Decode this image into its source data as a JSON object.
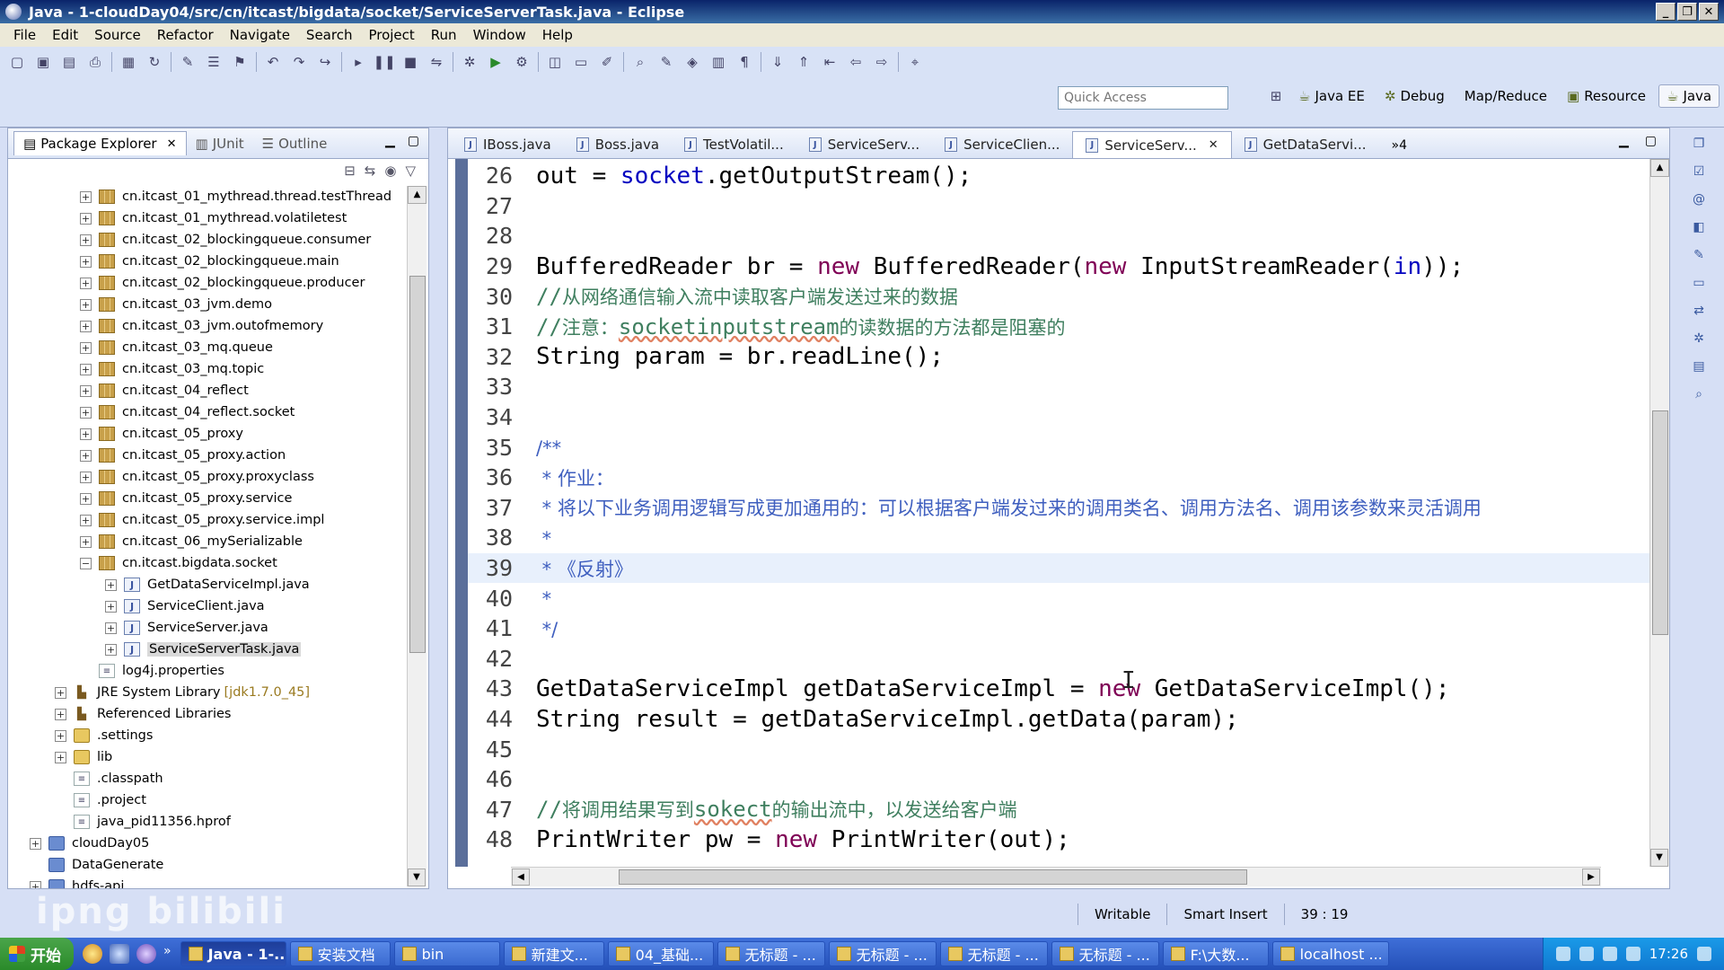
{
  "window": {
    "title": "Java - 1-cloudDay04/src/cn/itcast/bigdata/socket/ServiceServerTask.java - Eclipse",
    "controls": [
      "_",
      "❐",
      "✕"
    ]
  },
  "menu": [
    "File",
    "Edit",
    "Source",
    "Refactor",
    "Navigate",
    "Search",
    "Project",
    "Run",
    "Window",
    "Help"
  ],
  "toolbar": {
    "quick_access_placeholder": "Quick Access",
    "perspectives": [
      {
        "label": "Java EE",
        "icon": "java-ee-icon",
        "glyph": "☕"
      },
      {
        "label": "Debug",
        "icon": "debug-icon",
        "glyph": "✲"
      },
      {
        "label": "Map/Reduce",
        "icon": "mapreduce-icon",
        "glyph": ""
      },
      {
        "label": "Resource",
        "icon": "resource-icon",
        "glyph": "▣"
      },
      {
        "label": "Java",
        "icon": "java-icon",
        "glyph": "☕"
      }
    ]
  },
  "left_panel": {
    "tabs": [
      {
        "label": "Package Explorer",
        "icon": "package-explorer-icon",
        "glyph": "▤",
        "close": "✕"
      },
      {
        "label": "JUnit",
        "icon": "junit-icon",
        "glyph": "▥"
      },
      {
        "label": "Outline",
        "icon": "outline-icon",
        "glyph": "☰"
      }
    ],
    "tree": [
      {
        "label": "cn.itcast_01_mythread.thread.testThread",
        "indent": 2,
        "exp": "+",
        "icon": "pkg"
      },
      {
        "label": "cn.itcast_01_mythread.volatiletest",
        "indent": 2,
        "exp": "+",
        "icon": "pkg"
      },
      {
        "label": "cn.itcast_02_blockingqueue.consumer",
        "indent": 2,
        "exp": "+",
        "icon": "pkg"
      },
      {
        "label": "cn.itcast_02_blockingqueue.main",
        "indent": 2,
        "exp": "+",
        "icon": "pkg"
      },
      {
        "label": "cn.itcast_02_blockingqueue.producer",
        "indent": 2,
        "exp": "+",
        "icon": "pkg"
      },
      {
        "label": "cn.itcast_03_jvm.demo",
        "indent": 2,
        "exp": "+",
        "icon": "pkg"
      },
      {
        "label": "cn.itcast_03_jvm.outofmemory",
        "indent": 2,
        "exp": "+",
        "icon": "pkg"
      },
      {
        "label": "cn.itcast_03_mq.queue",
        "indent": 2,
        "exp": "+",
        "icon": "pkg"
      },
      {
        "label": "cn.itcast_03_mq.topic",
        "indent": 2,
        "exp": "+",
        "icon": "pkg"
      },
      {
        "label": "cn.itcast_04_reflect",
        "indent": 2,
        "exp": "+",
        "icon": "pkg"
      },
      {
        "label": "cn.itcast_04_reflect.socket",
        "indent": 2,
        "exp": "+",
        "icon": "pkg"
      },
      {
        "label": "cn.itcast_05_proxy",
        "indent": 2,
        "exp": "+",
        "icon": "pkg"
      },
      {
        "label": "cn.itcast_05_proxy.action",
        "indent": 2,
        "exp": "+",
        "icon": "pkg"
      },
      {
        "label": "cn.itcast_05_proxy.proxyclass",
        "indent": 2,
        "exp": "+",
        "icon": "pkg"
      },
      {
        "label": "cn.itcast_05_proxy.service",
        "indent": 2,
        "exp": "+",
        "icon": "pkg"
      },
      {
        "label": "cn.itcast_05_proxy.service.impl",
        "indent": 2,
        "exp": "+",
        "icon": "pkg"
      },
      {
        "label": "cn.itcast_06_mySerializable",
        "indent": 2,
        "exp": "+",
        "icon": "pkg"
      },
      {
        "label": "cn.itcast.bigdata.socket",
        "indent": 2,
        "exp": "−",
        "icon": "pkg"
      },
      {
        "label": "GetDataServiceImpl.java",
        "indent": 3,
        "exp": "+",
        "icon": "java"
      },
      {
        "label": "ServiceClient.java",
        "indent": 3,
        "exp": "+",
        "icon": "java"
      },
      {
        "label": "ServiceServer.java",
        "indent": 3,
        "exp": "+",
        "icon": "java"
      },
      {
        "label": "ServiceServerTask.java",
        "indent": 3,
        "exp": "+",
        "icon": "java",
        "selected": true
      },
      {
        "label": "log4j.properties",
        "indent": 2,
        "exp": "",
        "icon": "file"
      },
      {
        "label": "JRE System Library",
        "secondary": "[jdk1.7.0_45]",
        "indent": 1,
        "exp": "+",
        "icon": "lib"
      },
      {
        "label": "Referenced Libraries",
        "indent": 1,
        "exp": "+",
        "icon": "lib"
      },
      {
        "label": ".settings",
        "indent": 1,
        "exp": "+",
        "icon": "folder"
      },
      {
        "label": "lib",
        "indent": 1,
        "exp": "+",
        "icon": "folder"
      },
      {
        "label": ".classpath",
        "indent": 1,
        "exp": "",
        "icon": "file"
      },
      {
        "label": ".project",
        "indent": 1,
        "exp": "",
        "icon": "file"
      },
      {
        "label": "java_pid11356.hprof",
        "indent": 1,
        "exp": "",
        "icon": "file"
      },
      {
        "label": "cloudDay05",
        "indent": 0,
        "exp": "+",
        "icon": "project"
      },
      {
        "label": "DataGenerate",
        "indent": 0,
        "exp": "",
        "icon": "project"
      },
      {
        "label": "hdfs-api",
        "indent": 0,
        "exp": "+",
        "icon": "project"
      }
    ]
  },
  "editor": {
    "tabs": [
      {
        "label": "IBoss.java"
      },
      {
        "label": "Boss.java"
      },
      {
        "label": "TestVolatil..."
      },
      {
        "label": "ServiceServ..."
      },
      {
        "label": "ServiceClien..."
      },
      {
        "label": "ServiceServ...",
        "active": true
      },
      {
        "label": "GetDataServi..."
      }
    ],
    "overflow": "»4",
    "lines": [
      {
        "n": "26",
        "html": "out = <span class='param'>socket</span>.getOutputStream();"
      },
      {
        "n": "27",
        "html": ""
      },
      {
        "n": "28",
        "html": ""
      },
      {
        "n": "29",
        "html": "BufferedReader br = <span class='kw'>new</span> BufferedReader(<span class='kw'>new</span> InputStreamReader(<span class='param'>in</span>));"
      },
      {
        "n": "30",
        "html": "<span class='comment'><span class='mono'>//</span>从网络通信输入流中读取客户端发送过来的数据</span>"
      },
      {
        "n": "31",
        "html": "<span class='comment'><span class='mono'>//</span>注意：<span class='mono squiggle'>socketinputstream</span>的读数据的方法都是阻塞的</span>"
      },
      {
        "n": "32",
        "html": "String param = br.readLine();"
      },
      {
        "n": "33",
        "html": ""
      },
      {
        "n": "34",
        "html": ""
      },
      {
        "n": "35",
        "html": "<span class='javadoc'><span class='mono'>/**</span></span>"
      },
      {
        "n": "36",
        "html": "<span class='javadoc'><span class='mono'> *</span> 作业：</span>"
      },
      {
        "n": "37",
        "html": "<span class='javadoc'><span class='mono'> *</span> 将以下业务调用逻辑写成更加通用的：可以根据客户端发过来的调用类名、调用方法名、调用该参数来灵活调用</span>"
      },
      {
        "n": "38",
        "html": "<span class='javadoc'><span class='mono'> *</span></span>"
      },
      {
        "n": "39",
        "html": "<span class='javadoc'><span class='mono'> *</span> 《反射》</span>",
        "current": true
      },
      {
        "n": "40",
        "html": "<span class='javadoc'><span class='mono'> *</span></span>"
      },
      {
        "n": "41",
        "html": "<span class='javadoc'><span class='mono'> */</span></span>"
      },
      {
        "n": "42",
        "html": ""
      },
      {
        "n": "43",
        "html": "GetDataServiceImpl getDataServiceImpl = <span class='kw'>new</span> GetDataServiceImpl();"
      },
      {
        "n": "44",
        "html": "String result = getDataServiceImpl.getData(param);"
      },
      {
        "n": "45",
        "html": ""
      },
      {
        "n": "46",
        "html": ""
      },
      {
        "n": "47",
        "html": "<span class='comment'><span class='mono'>//</span>将调用结果写到<span class='mono squiggle'>sokect</span>的输出流中，以发送给客户端</span>"
      },
      {
        "n": "48",
        "html": "PrintWriter pw = <span class='kw'>new</span> PrintWriter(out);"
      }
    ]
  },
  "watermark": "ipng bilibili",
  "status": {
    "writable": "Writable",
    "insert_mode": "Smart Insert",
    "position": "39 : 19"
  },
  "taskbar": {
    "start": "开始",
    "quick_launch_more": "»",
    "tasks": [
      {
        "label": "Java - 1-...",
        "active": true
      },
      {
        "label": "安装文档"
      },
      {
        "label": "bin"
      },
      {
        "label": "新建文..."
      },
      {
        "label": "04_基础..."
      },
      {
        "label": "无标题 - ..."
      },
      {
        "label": "无标题 - ..."
      },
      {
        "label": "无标题 - ..."
      },
      {
        "label": "无标题 - ..."
      },
      {
        "label": "F:\\大数..."
      },
      {
        "label": "localhost ..."
      }
    ],
    "clock": "17:26"
  }
}
